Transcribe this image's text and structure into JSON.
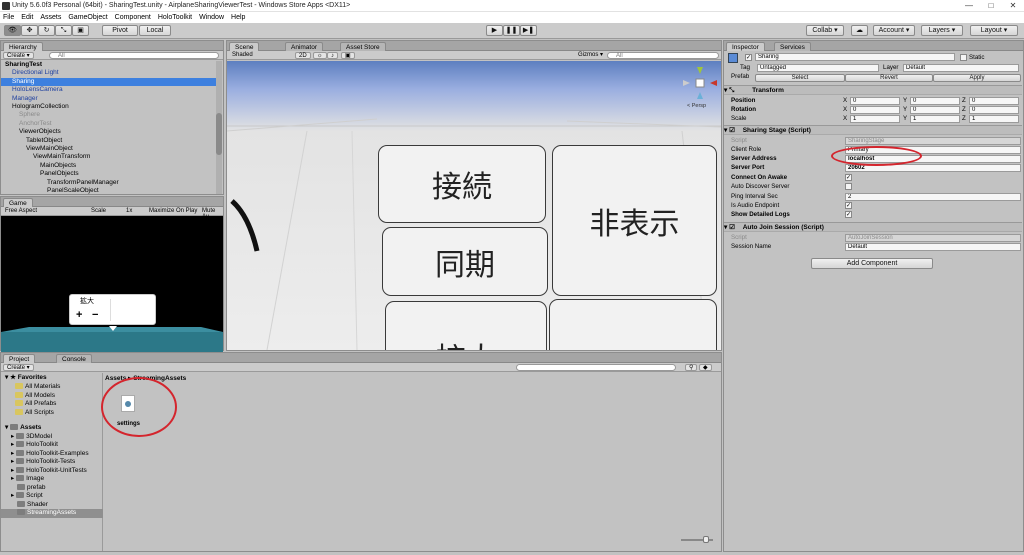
{
  "window": {
    "title": "Unity 5.6.0f3 Personal (64bit) - SharingTest.unity - AirplaneSharingViewerTest - Windows Store Apps <DX11>",
    "min": "—",
    "max": "□",
    "close": "✕"
  },
  "menu": [
    "File",
    "Edit",
    "Assets",
    "GameObject",
    "Component",
    "HoloToolkit",
    "Window",
    "Help"
  ],
  "toolbar": {
    "pivot": "Pivot",
    "local": "Local",
    "play": "▶",
    "pause": "❚❚",
    "step": "▶❚",
    "collab": "Collab ▾",
    "cloud": "☁",
    "account": "Account ▾",
    "layers": "Layers ▾",
    "layout": "Layout ▾"
  },
  "hierarchy": {
    "tab": "Hierarchy",
    "create": "Create ▾",
    "search": "All",
    "items": [
      {
        "label": "SharingTest",
        "indent": 0,
        "style": "bold"
      },
      {
        "label": "Directional Light",
        "indent": 1,
        "style": "blue"
      },
      {
        "label": "Sharing",
        "indent": 1,
        "style": "selected"
      },
      {
        "label": "HoloLensCamera",
        "indent": 1,
        "style": "blue"
      },
      {
        "label": "Manager",
        "indent": 1,
        "style": "blue"
      },
      {
        "label": "HologramCollection",
        "indent": 1,
        "style": ""
      },
      {
        "label": "Sphere",
        "indent": 2,
        "style": "gray"
      },
      {
        "label": "AnchorTest",
        "indent": 2,
        "style": "gray"
      },
      {
        "label": "ViewerObjects",
        "indent": 2,
        "style": ""
      },
      {
        "label": "TabletObject",
        "indent": 3,
        "style": ""
      },
      {
        "label": "ViewMainObject",
        "indent": 3,
        "style": ""
      },
      {
        "label": "ViewMainTransform",
        "indent": 4,
        "style": ""
      },
      {
        "label": "MainObjects",
        "indent": 5,
        "style": ""
      },
      {
        "label": "PanelObjects",
        "indent": 5,
        "style": ""
      },
      {
        "label": "TransformPanelManager",
        "indent": 6,
        "style": ""
      },
      {
        "label": "PanelScaleObject",
        "indent": 6,
        "style": ""
      }
    ]
  },
  "game": {
    "tab": "Game",
    "aspect": "Free Aspect",
    "scale": "Scale",
    "scale_val": "1x",
    "maximize": "Maximize On Play",
    "mute": "Mute Au",
    "popup_title": "拡大",
    "plus": "+",
    "minus": "−"
  },
  "scene": {
    "tabs": [
      "Scene",
      "Animator",
      "Asset Store"
    ],
    "shaded": "Shaded",
    "mode2d": "2D",
    "gizmos": "Gizmos ▾",
    "search": "All",
    "persp": "< Persp",
    "keys": [
      "接続",
      "非表示",
      "同期",
      "拡大"
    ]
  },
  "project": {
    "tabs": [
      "Project",
      "Console"
    ],
    "create": "Create ▾",
    "breadcrumb": "Assets ▸ StreamingAssets",
    "favorites": {
      "label": "Favorites",
      "items": [
        "All Materials",
        "All Models",
        "All Prefabs",
        "All Scripts"
      ]
    },
    "assets": {
      "label": "Assets",
      "items": [
        "3DModel",
        "HoloToolkit",
        "HoloToolkit-Examples",
        "HoloToolkit-Tests",
        "HoloToolkit-UnitTests",
        "Image",
        "prefab",
        "Script",
        "Shader",
        "StreamingAssets"
      ]
    },
    "file": "settings"
  },
  "inspector": {
    "tabs": [
      "Inspector",
      "Services"
    ],
    "object_name": "Sharing",
    "static": "Static",
    "tag_label": "Tag",
    "tag": "Untagged",
    "layer_label": "Layer",
    "layer": "Default",
    "prefab_label": "Prefab",
    "select": "Select",
    "revert": "Revert",
    "apply": "Apply",
    "transform": {
      "title": "Transform",
      "rows": [
        {
          "label": "Position",
          "x": "0",
          "y": "0",
          "z": "0"
        },
        {
          "label": "Rotation",
          "x": "0",
          "y": "0",
          "z": "0"
        },
        {
          "label": "Scale",
          "x": "1",
          "y": "1",
          "z": "1"
        }
      ]
    },
    "sharing": {
      "title": "Sharing Stage (Script)",
      "script_label": "Script",
      "script": "SharingStage",
      "client_role_label": "Client Role",
      "client_role": "Primary",
      "server_address_label": "Server Address",
      "server_address": "localhost",
      "server_port_label": "Server Port",
      "server_port": "20602",
      "connect_label": "Connect On Awake",
      "auto_label": "Auto Discover Server",
      "ping_label": "Ping Interval Sec",
      "ping": "2",
      "audio_label": "Is Audio Endpoint",
      "detailed_label": "Show Detailed Logs"
    },
    "autojoin": {
      "title": "Auto Join Session (Script)",
      "script_label": "Script",
      "script": "AutoJoinSession",
      "session_label": "Session Name",
      "session": "Default"
    },
    "add_component": "Add Component"
  }
}
